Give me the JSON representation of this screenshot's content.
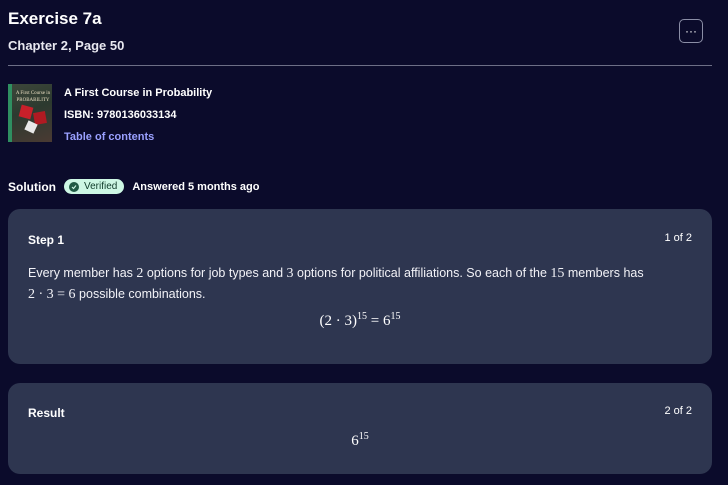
{
  "header": {
    "title": "Exercise 7a",
    "subtitle": "Chapter 2, Page 50",
    "more_label": "···"
  },
  "book": {
    "cover_title": "A First Course in PROBABILITY",
    "title": "A First Course in Probability",
    "isbn": "ISBN: 9780136033134",
    "toc_link": "Table of contents"
  },
  "solution": {
    "label": "Solution",
    "badge": "Verified",
    "answered": "Answered 5 months ago"
  },
  "steps": [
    {
      "heading": "Step 1",
      "count": "1 of 2",
      "text_parts": [
        "Every member has ",
        "2",
        " options for job types and ",
        "3",
        " options for political affiliations. So each of the ",
        "15",
        " members has ",
        "2 · 3 = 6",
        " possible combinations."
      ],
      "formula_base": "(2 · 3)",
      "formula_exp": "15",
      "formula_mid": " = 6",
      "formula_exp2": "15"
    },
    {
      "heading": "Result",
      "count": "2 of 2",
      "result_base": "6",
      "result_exp": "15"
    }
  ],
  "colors": {
    "background": "#0b0b2b",
    "card": "#2e3650",
    "badge": "#cdf7e4",
    "link": "#9aa0ff"
  }
}
